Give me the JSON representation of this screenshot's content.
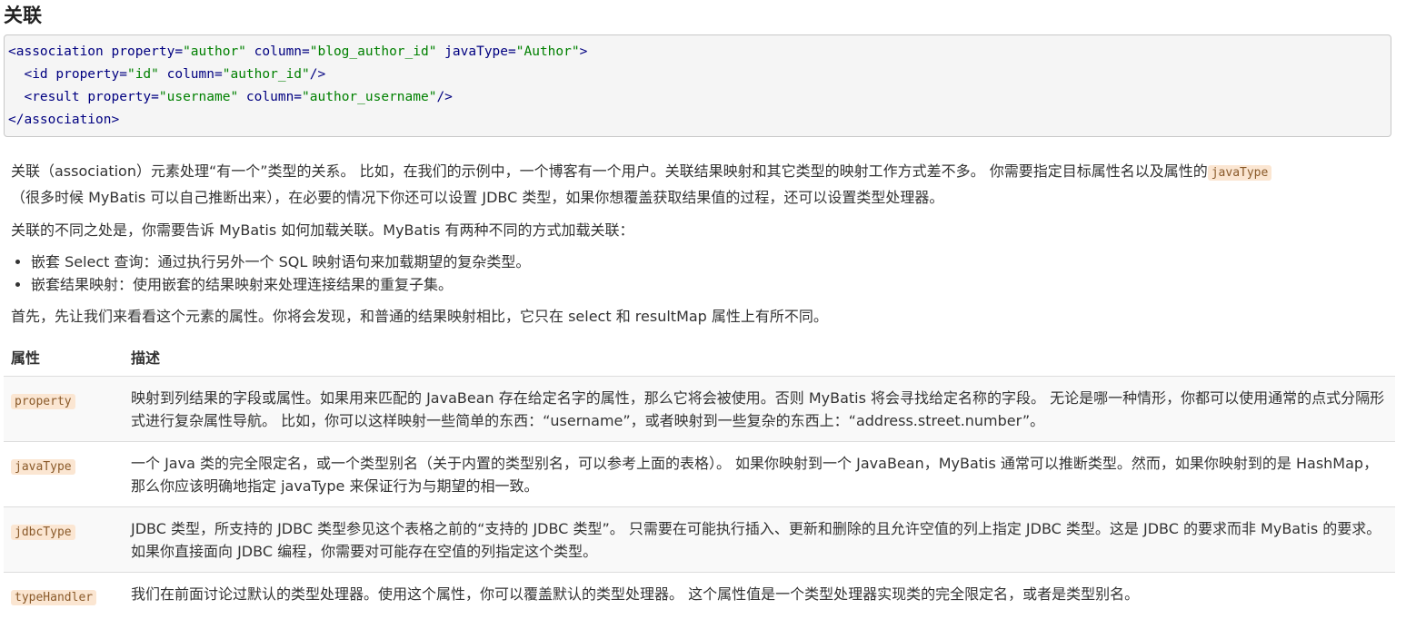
{
  "section": {
    "heading": "关联"
  },
  "code_block": {
    "line1": {
      "open": "<association ",
      "a1": "property=",
      "v1": "\"author\"",
      "a2": " column=",
      "v2": "\"blog_author_id\"",
      "a3": " javaType=",
      "v3": "\"Author\"",
      "close": ">"
    },
    "line2": {
      "open": "  <id ",
      "a1": "property=",
      "v1": "\"id\"",
      "a2": " column=",
      "v2": "\"author_id\"",
      "close": "/>"
    },
    "line3": {
      "open": "  <result ",
      "a1": "property=",
      "v1": "\"username\"",
      "a2": " column=",
      "v2": "\"author_username\"",
      "close": "/>"
    },
    "line4": {
      "text": "</association>"
    }
  },
  "paragraphs": {
    "intro_part1": "关联（association）元素处理“有一个”类型的关系。 比如，在我们的示例中，一个博客有一个用户。关联结果映射和其它类型的映射工作方式差不多。 你需要指定目标属性名以及属性的",
    "intro_code": "javaType",
    "intro_part2": "（很多时候 MyBatis 可以自己推断出来），在必要的情况下你还可以设置 JDBC 类型，如果你想覆盖获取结果值的过程，还可以设置类型处理器。",
    "second": "关联的不同之处是，你需要告诉 MyBatis 如何加载关联。MyBatis 有两种不同的方式加载关联：",
    "bullets": [
      "嵌套 Select 查询：通过执行另外一个 SQL 映射语句来加载期望的复杂类型。",
      "嵌套结果映射：使用嵌套的结果映射来处理连接结果的重复子集。"
    ],
    "third": "首先，先让我们来看看这个元素的属性。你将会发现，和普通的结果映射相比，它只在 select 和 resultMap 属性上有所不同。"
  },
  "table": {
    "headers": [
      "属性",
      "描述"
    ],
    "rows": [
      {
        "attr": "property",
        "desc": "映射到列结果的字段或属性。如果用来匹配的 JavaBean 存在给定名字的属性，那么它将会被使用。否则 MyBatis 将会寻找给定名称的字段。 无论是哪一种情形，你都可以使用通常的点式分隔形式进行复杂属性导航。 比如，你可以这样映射一些简单的东西：“username”，或者映射到一些复杂的东西上：“address.street.number”。"
      },
      {
        "attr": "javaType",
        "desc": "一个 Java 类的完全限定名，或一个类型别名（关于内置的类型别名，可以参考上面的表格）。 如果你映射到一个 JavaBean，MyBatis 通常可以推断类型。然而，如果你映射到的是 HashMap，那么你应该明确地指定 javaType 来保证行为与期望的相一致。"
      },
      {
        "attr": "jdbcType",
        "desc": "JDBC 类型，所支持的 JDBC 类型参见这个表格之前的“支持的 JDBC 类型”。 只需要在可能执行插入、更新和删除的且允许空值的列上指定 JDBC 类型。这是 JDBC 的要求而非 MyBatis 的要求。如果你直接面向 JDBC 编程，你需要对可能存在空值的列指定这个类型。"
      },
      {
        "attr": "typeHandler",
        "desc": "我们在前面讨论过默认的类型处理器。使用这个属性，你可以覆盖默认的类型处理器。 这个属性值是一个类型处理器实现类的完全限定名，或者是类型别名。"
      }
    ]
  }
}
